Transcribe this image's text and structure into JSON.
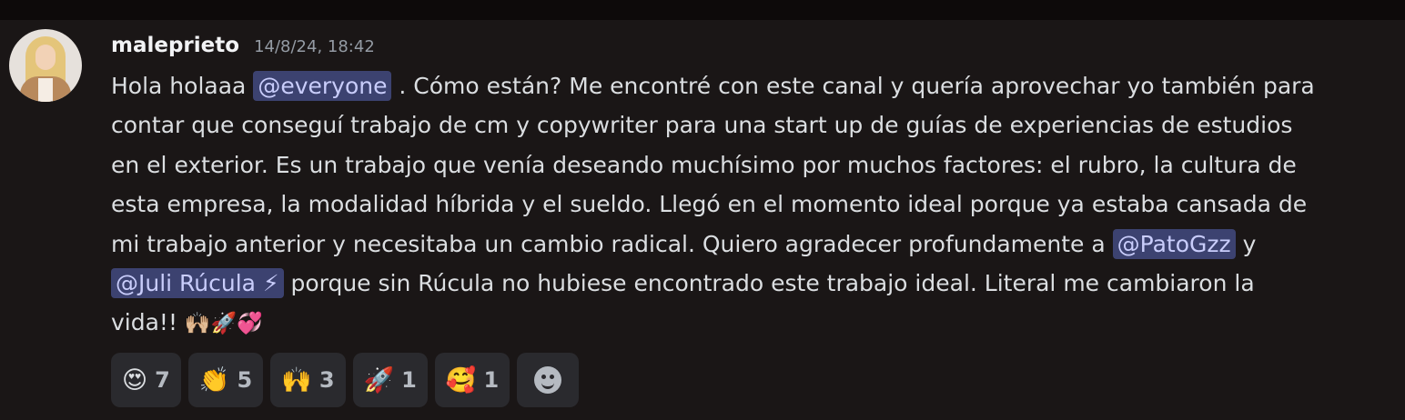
{
  "message": {
    "author": "maleprieto",
    "timestamp": "14/8/24, 18:42",
    "mentions": {
      "everyone": "@everyone",
      "pato": "@PatoGzz",
      "juli": "@Juli Rúcula ⚡"
    },
    "lines": {
      "l1_a": "Hola holaaa ",
      "l1_b": " . Cómo están? Me encontré con este canal y quería aprovechar yo también para",
      "l2": "contar que conseguí trabajo de cm y copywriter para una start up de guías de experiencias de estudios",
      "l3": "en el exterior. Es un trabajo que venía deseando muchísimo por muchos factores: el rubro, la cultura de",
      "l4": "esta empresa, la modalidad híbrida y el sueldo. Llegó en el momento ideal porque ya estaba cansada de",
      "l5_a": "mi trabajo anterior y necesitaba un cambio radical. Quiero agradecer profundamente a ",
      "l5_b": " y",
      "l6_b": " porque sin Rúcula no hubiese encontrado este trabajo ideal. Literal me cambiaron la",
      "l7": "vida!! ",
      "l7_emoji": "🙌🏼🚀💞"
    }
  },
  "reactions": [
    {
      "emoji": "😍",
      "count": "7"
    },
    {
      "emoji": "👏",
      "count": "5"
    },
    {
      "emoji": "🙌",
      "count": "3"
    },
    {
      "emoji": "🚀",
      "count": "1"
    },
    {
      "emoji": "🥰",
      "count": "1"
    }
  ],
  "add_reaction_icon": "smiley-icon"
}
